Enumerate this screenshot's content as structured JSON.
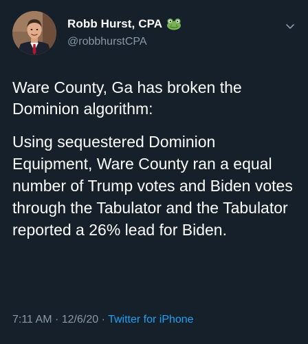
{
  "tweet": {
    "author": {
      "display_name": "Robb Hurst, CPA",
      "handle": "@robbhurstCPA",
      "badge_emoji": "frog-emoji",
      "avatar": "profile-photo"
    },
    "text_paragraph_1": "Ware County, Ga has broken the Dominion algorithm:",
    "text_paragraph_2": "Using sequestered Dominion Equipment, Ware County ran a equal number of Trump votes and Biden votes through the Tabulator and the Tabulator reported a 26% lead for Biden.",
    "time": "7:11 AM",
    "date": "12/6/20",
    "separator": "·",
    "source": "Twitter for iPhone"
  },
  "icons": {
    "menu": "chevron-down-icon"
  },
  "colors": {
    "background": "#15202b",
    "text": "#ffffff",
    "secondary_text": "#8899a6",
    "link": "#1da1f2"
  }
}
